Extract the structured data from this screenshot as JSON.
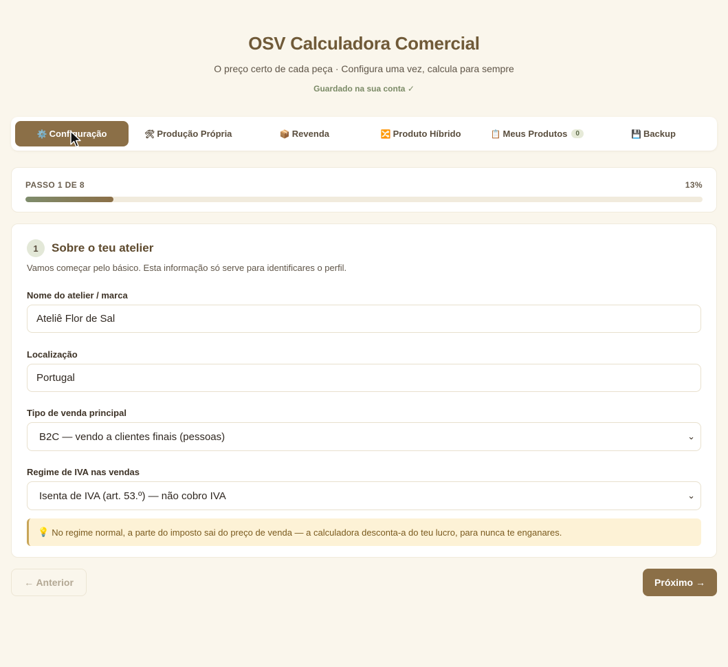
{
  "header": {
    "title": "OSV Calculadora Comercial",
    "subtitle": "O preço certo de cada peça · Configura uma vez, calcula para sempre",
    "saved": "Guardado na sua conta ✓"
  },
  "tabs": [
    {
      "icon": "⚙️",
      "icon_name": "gear-icon",
      "label": "Configuração",
      "active": true
    },
    {
      "icon": "🛠",
      "icon_name": "tools-icon",
      "label": "Produção Própria"
    },
    {
      "icon": "📦",
      "icon_name": "package-icon",
      "label": "Revenda"
    },
    {
      "icon": "🔀",
      "icon_name": "shuffle-icon",
      "label": "Produto Híbrido"
    },
    {
      "icon": "📋",
      "icon_name": "clipboard-icon",
      "label": "Meus Produtos",
      "badge": "0"
    },
    {
      "icon": "💾",
      "icon_name": "floppy-disk-icon",
      "label": "Backup"
    }
  ],
  "progress": {
    "step_label": "PASSO 1 DE 8",
    "percent_label": "13%",
    "fraction": 0.13
  },
  "step": {
    "number": "1",
    "title": "Sobre o teu atelier",
    "description": "Vamos começar pelo básico. Esta informação só serve para identificares o perfil."
  },
  "fields": {
    "name": {
      "label": "Nome do atelier / marca",
      "value": "Ateliê Flor de Sal"
    },
    "location": {
      "label": "Localização",
      "value": "Portugal"
    },
    "sale_type": {
      "label": "Tipo de venda principal",
      "value": "B2C — vendo a clientes finais (pessoas)"
    },
    "vat": {
      "label": "Regime de IVA nas vendas",
      "value": "Isenta de IVA (art. 53.º) — não cobro IVA"
    }
  },
  "tip": {
    "icon": "💡",
    "text": "No regime normal, a parte do imposto sai do preço de venda — a calculadora desconta-a do teu lucro, para nunca te enganares."
  },
  "nav": {
    "prev": "← Anterior",
    "next": "Próximo →"
  },
  "colors": {
    "accent": "#8b6f47",
    "background": "#faf6ec",
    "tip_background": "#fdf2d6"
  }
}
